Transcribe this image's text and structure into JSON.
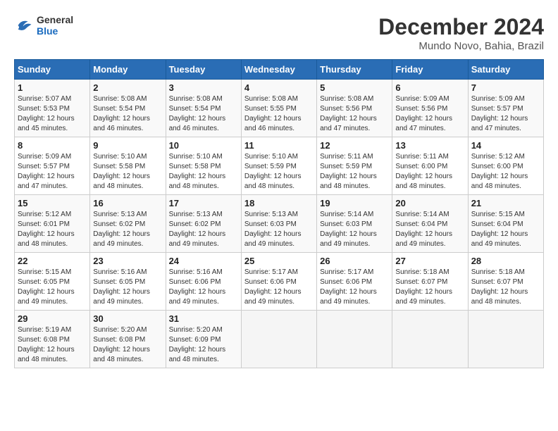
{
  "header": {
    "logo_general": "General",
    "logo_blue": "Blue",
    "month_title": "December 2024",
    "location": "Mundo Novo, Bahia, Brazil"
  },
  "weekdays": [
    "Sunday",
    "Monday",
    "Tuesday",
    "Wednesday",
    "Thursday",
    "Friday",
    "Saturday"
  ],
  "weeks": [
    [
      {
        "day": "1",
        "sunrise": "5:07 AM",
        "sunset": "5:53 PM",
        "daylight": "12 hours and 45 minutes."
      },
      {
        "day": "2",
        "sunrise": "5:08 AM",
        "sunset": "5:54 PM",
        "daylight": "12 hours and 46 minutes."
      },
      {
        "day": "3",
        "sunrise": "5:08 AM",
        "sunset": "5:54 PM",
        "daylight": "12 hours and 46 minutes."
      },
      {
        "day": "4",
        "sunrise": "5:08 AM",
        "sunset": "5:55 PM",
        "daylight": "12 hours and 46 minutes."
      },
      {
        "day": "5",
        "sunrise": "5:08 AM",
        "sunset": "5:56 PM",
        "daylight": "12 hours and 47 minutes."
      },
      {
        "day": "6",
        "sunrise": "5:09 AM",
        "sunset": "5:56 PM",
        "daylight": "12 hours and 47 minutes."
      },
      {
        "day": "7",
        "sunrise": "5:09 AM",
        "sunset": "5:57 PM",
        "daylight": "12 hours and 47 minutes."
      }
    ],
    [
      {
        "day": "8",
        "sunrise": "5:09 AM",
        "sunset": "5:57 PM",
        "daylight": "12 hours and 47 minutes."
      },
      {
        "day": "9",
        "sunrise": "5:10 AM",
        "sunset": "5:58 PM",
        "daylight": "12 hours and 48 minutes."
      },
      {
        "day": "10",
        "sunrise": "5:10 AM",
        "sunset": "5:58 PM",
        "daylight": "12 hours and 48 minutes."
      },
      {
        "day": "11",
        "sunrise": "5:10 AM",
        "sunset": "5:59 PM",
        "daylight": "12 hours and 48 minutes."
      },
      {
        "day": "12",
        "sunrise": "5:11 AM",
        "sunset": "5:59 PM",
        "daylight": "12 hours and 48 minutes."
      },
      {
        "day": "13",
        "sunrise": "5:11 AM",
        "sunset": "6:00 PM",
        "daylight": "12 hours and 48 minutes."
      },
      {
        "day": "14",
        "sunrise": "5:12 AM",
        "sunset": "6:00 PM",
        "daylight": "12 hours and 48 minutes."
      }
    ],
    [
      {
        "day": "15",
        "sunrise": "5:12 AM",
        "sunset": "6:01 PM",
        "daylight": "12 hours and 48 minutes."
      },
      {
        "day": "16",
        "sunrise": "5:13 AM",
        "sunset": "6:02 PM",
        "daylight": "12 hours and 49 minutes."
      },
      {
        "day": "17",
        "sunrise": "5:13 AM",
        "sunset": "6:02 PM",
        "daylight": "12 hours and 49 minutes."
      },
      {
        "day": "18",
        "sunrise": "5:13 AM",
        "sunset": "6:03 PM",
        "daylight": "12 hours and 49 minutes."
      },
      {
        "day": "19",
        "sunrise": "5:14 AM",
        "sunset": "6:03 PM",
        "daylight": "12 hours and 49 minutes."
      },
      {
        "day": "20",
        "sunrise": "5:14 AM",
        "sunset": "6:04 PM",
        "daylight": "12 hours and 49 minutes."
      },
      {
        "day": "21",
        "sunrise": "5:15 AM",
        "sunset": "6:04 PM",
        "daylight": "12 hours and 49 minutes."
      }
    ],
    [
      {
        "day": "22",
        "sunrise": "5:15 AM",
        "sunset": "6:05 PM",
        "daylight": "12 hours and 49 minutes."
      },
      {
        "day": "23",
        "sunrise": "5:16 AM",
        "sunset": "6:05 PM",
        "daylight": "12 hours and 49 minutes."
      },
      {
        "day": "24",
        "sunrise": "5:16 AM",
        "sunset": "6:06 PM",
        "daylight": "12 hours and 49 minutes."
      },
      {
        "day": "25",
        "sunrise": "5:17 AM",
        "sunset": "6:06 PM",
        "daylight": "12 hours and 49 minutes."
      },
      {
        "day": "26",
        "sunrise": "5:17 AM",
        "sunset": "6:06 PM",
        "daylight": "12 hours and 49 minutes."
      },
      {
        "day": "27",
        "sunrise": "5:18 AM",
        "sunset": "6:07 PM",
        "daylight": "12 hours and 49 minutes."
      },
      {
        "day": "28",
        "sunrise": "5:18 AM",
        "sunset": "6:07 PM",
        "daylight": "12 hours and 48 minutes."
      }
    ],
    [
      {
        "day": "29",
        "sunrise": "5:19 AM",
        "sunset": "6:08 PM",
        "daylight": "12 hours and 48 minutes."
      },
      {
        "day": "30",
        "sunrise": "5:20 AM",
        "sunset": "6:08 PM",
        "daylight": "12 hours and 48 minutes."
      },
      {
        "day": "31",
        "sunrise": "5:20 AM",
        "sunset": "6:09 PM",
        "daylight": "12 hours and 48 minutes."
      },
      null,
      null,
      null,
      null
    ]
  ],
  "labels": {
    "sunrise": "Sunrise:",
    "sunset": "Sunset:",
    "daylight": "Daylight:"
  }
}
